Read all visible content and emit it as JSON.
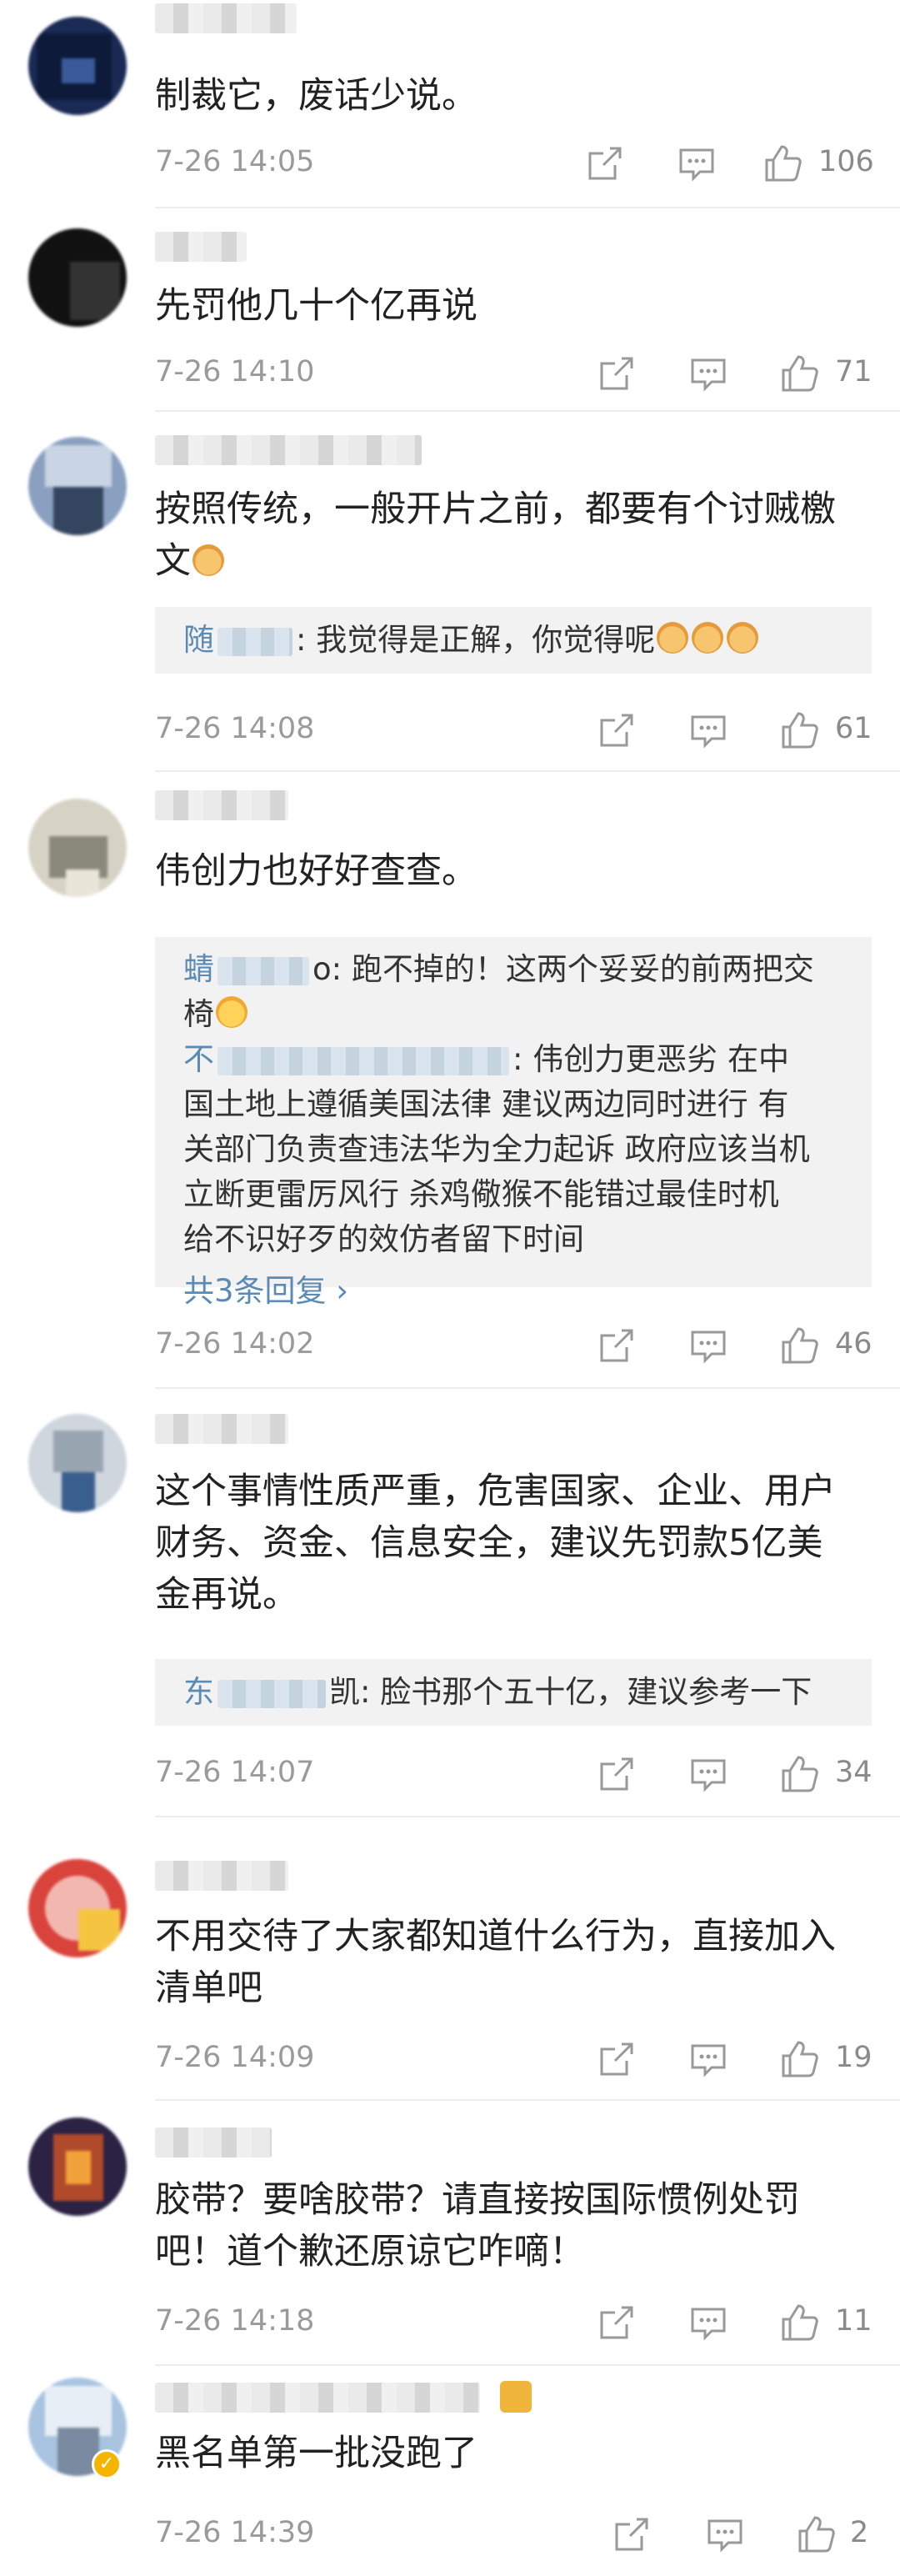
{
  "comments": [
    {
      "text": "制裁它，废话少说。",
      "time": "7-26 14:05",
      "likes": "106",
      "replies": []
    },
    {
      "text": "先罚他几十个亿再说",
      "time": "7-26 14:10",
      "likes": "71",
      "replies": []
    },
    {
      "text": "按照传统，一般开片之前，都要有个讨贼檄\n文",
      "time": "7-26 14:08",
      "likes": "61",
      "replies": [
        {
          "name": "随",
          "text": ": 我觉得是正解，你觉得呢"
        }
      ]
    },
    {
      "text": "伟创力也好好查查。",
      "time": "7-26 14:02",
      "likes": "46",
      "replies": [
        {
          "name": "蜻",
          "text": "o: 跑不掉的！这两个妥妥的前两把交\n椅"
        },
        {
          "name": "不",
          "text": ": 伟创力更恶劣 在中\n国土地上遵循美国法律 建议两边同时进行 有\n关部门负责查违法华为全力起诉 政府应该当机\n立断更雷厉风行 杀鸡儆猴不能错过最佳时机\n给不识好歹的效仿者留下时间"
        }
      ],
      "more": "共3条回复 ›"
    },
    {
      "text": "这个事情性质严重，危害国家、企业、用户\n财务、资金、信息安全，建议先罚款5亿美\n金再说。",
      "time": "7-26 14:07",
      "likes": "34",
      "replies": [
        {
          "name": "东",
          "text": "凯: 脸书那个五十亿，建议参考一下"
        }
      ]
    },
    {
      "text": "不用交待了大家都知道什么行为，直接加入\n清单吧",
      "time": "7-26 14:09",
      "likes": "19",
      "replies": []
    },
    {
      "text": "胶带？要啥胶带？请直接按国际惯例处罚\n吧！道个歉还原谅它咋嘀！",
      "time": "7-26 14:18",
      "likes": "11",
      "replies": []
    },
    {
      "text": "黑名单第一批没跑了",
      "time": "7-26 14:39",
      "likes": "2",
      "replies": []
    }
  ],
  "icons": {
    "share": "share-icon",
    "comment": "comment-icon",
    "like": "thumbs-up-icon"
  },
  "colors": {
    "link": "#5b8bb5",
    "meta": "#9a9a9a",
    "reply_bg": "#f2f2f2"
  }
}
